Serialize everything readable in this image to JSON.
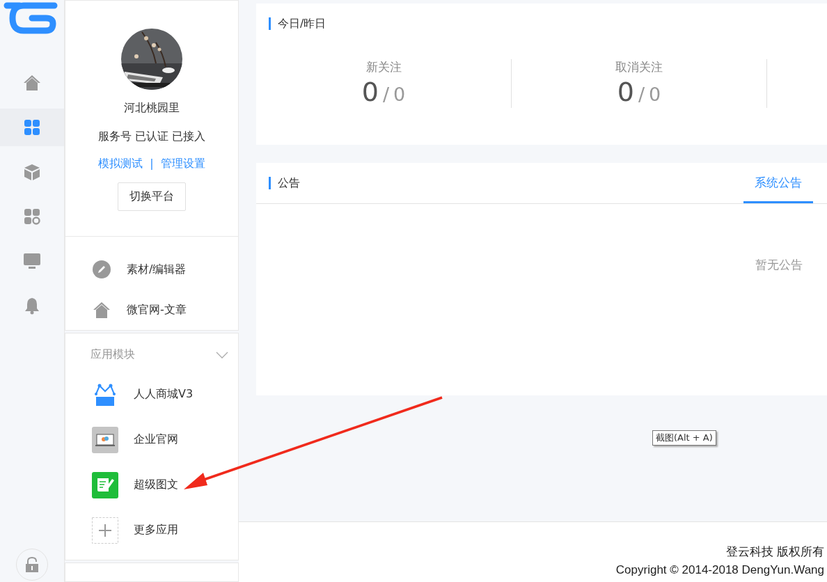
{
  "rail": {
    "items": [
      {
        "kind": "home",
        "selected": false
      },
      {
        "kind": "grid",
        "selected": true
      },
      {
        "kind": "cube",
        "selected": false
      },
      {
        "kind": "apps",
        "selected": false
      },
      {
        "kind": "monitor",
        "selected": false
      },
      {
        "kind": "bell",
        "selected": false
      }
    ]
  },
  "account": {
    "name": "河北桃园里",
    "status": "服务号 已认证 已接入",
    "links": [
      "模拟测试",
      "管理设置"
    ],
    "separator": "|",
    "switch_button": "切换平台"
  },
  "menu": [
    {
      "label": "素材/编辑器",
      "kind": "pencil"
    },
    {
      "label": "微官网-文章",
      "kind": "home"
    }
  ],
  "section": {
    "title": "应用模块",
    "expanded": true,
    "apps": [
      {
        "label": "人人商城V3",
        "kind": "shop"
      },
      {
        "label": "企业官网",
        "kind": "laptop"
      },
      {
        "label": "超级图文",
        "kind": "note"
      },
      {
        "label": "更多应用",
        "kind": "plus"
      }
    ]
  },
  "stats": {
    "title": "今日/昨日",
    "items": [
      {
        "label": "新关注",
        "today": "0",
        "separator": "/",
        "yesterday": "0"
      },
      {
        "label": "取消关注",
        "today": "0",
        "separator": "/",
        "yesterday": "0"
      }
    ]
  },
  "notice": {
    "title": "公告",
    "tabs": [
      {
        "label": "系统公告",
        "selected": true
      }
    ],
    "empty": "暂无公告"
  },
  "tooltip": "截图(Alt + A)",
  "footer": [
    "登云科技 版权所有",
    "Copyright © 2014-2018 DengYun.Wang"
  ]
}
